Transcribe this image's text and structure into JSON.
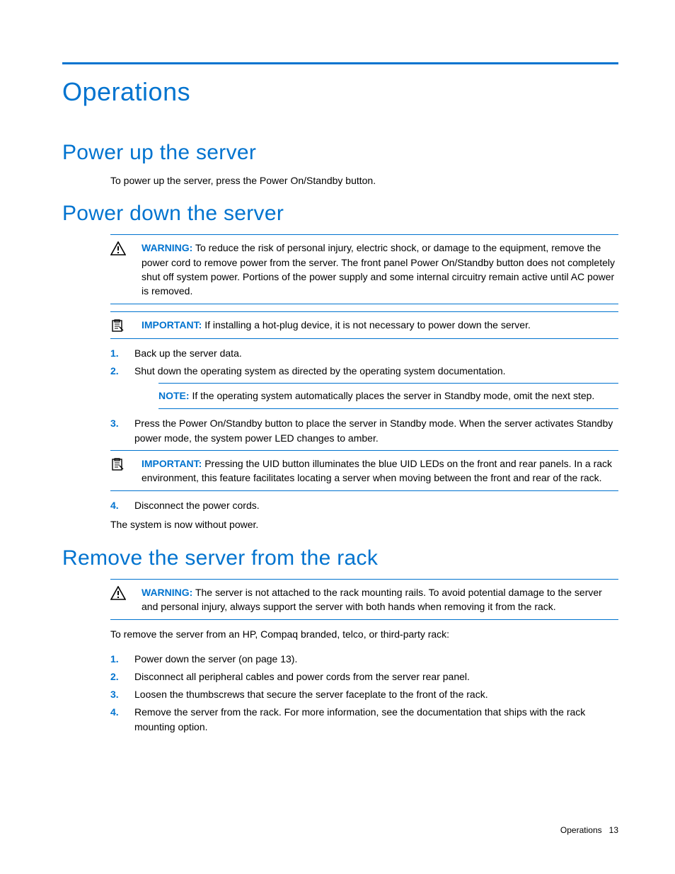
{
  "page": {
    "title": "Operations",
    "footer_section": "Operations",
    "footer_page": "13"
  },
  "sections": {
    "power_up": {
      "heading": "Power up the server",
      "body": "To power up the server, press the Power On/Standby button."
    },
    "power_down": {
      "heading": "Power down the server",
      "warning_label": "WARNING:",
      "warning_text": "To reduce the risk of personal injury, electric shock, or damage to the equipment, remove the power cord to remove power from the server. The front panel Power On/Standby button does not completely shut off system power. Portions of the power supply and some internal circuitry remain active until AC power is removed.",
      "important1_label": "IMPORTANT:",
      "important1_text": "If installing a hot-plug device, it is not necessary to power down the server.",
      "steps": [
        "Back up the server data.",
        "Shut down the operating system as directed by the operating system documentation.",
        "Press the Power On/Standby button to place the server in Standby mode. When the server activates Standby power mode, the system power LED changes to amber.",
        "Disconnect the power cords."
      ],
      "note_label": "NOTE:",
      "note_text": "If the operating system automatically places the server in Standby mode, omit the next step.",
      "important2_label": "IMPORTANT:",
      "important2_text": "Pressing the UID button illuminates the blue UID LEDs on the front and rear panels. In a rack environment, this feature facilitates locating a server when moving between the front and rear of the rack.",
      "closing": "The system is now without power."
    },
    "remove_rack": {
      "heading": "Remove the server from the rack",
      "warning_label": "WARNING:",
      "warning_text": "The server is not attached to the rack mounting rails. To avoid potential damage to the server and personal injury, always support the server with both hands when removing it from the rack.",
      "intro": "To remove the server from an HP, Compaq branded, telco, or third-party rack:",
      "steps": [
        "Power down the server (on page 13).",
        "Disconnect all peripheral cables and power cords from the server rear panel.",
        "Loosen the thumbscrews that secure the server faceplate to the front of the rack.",
        "Remove the server from the rack. For more information, see the documentation that ships with the rack mounting option."
      ]
    }
  }
}
